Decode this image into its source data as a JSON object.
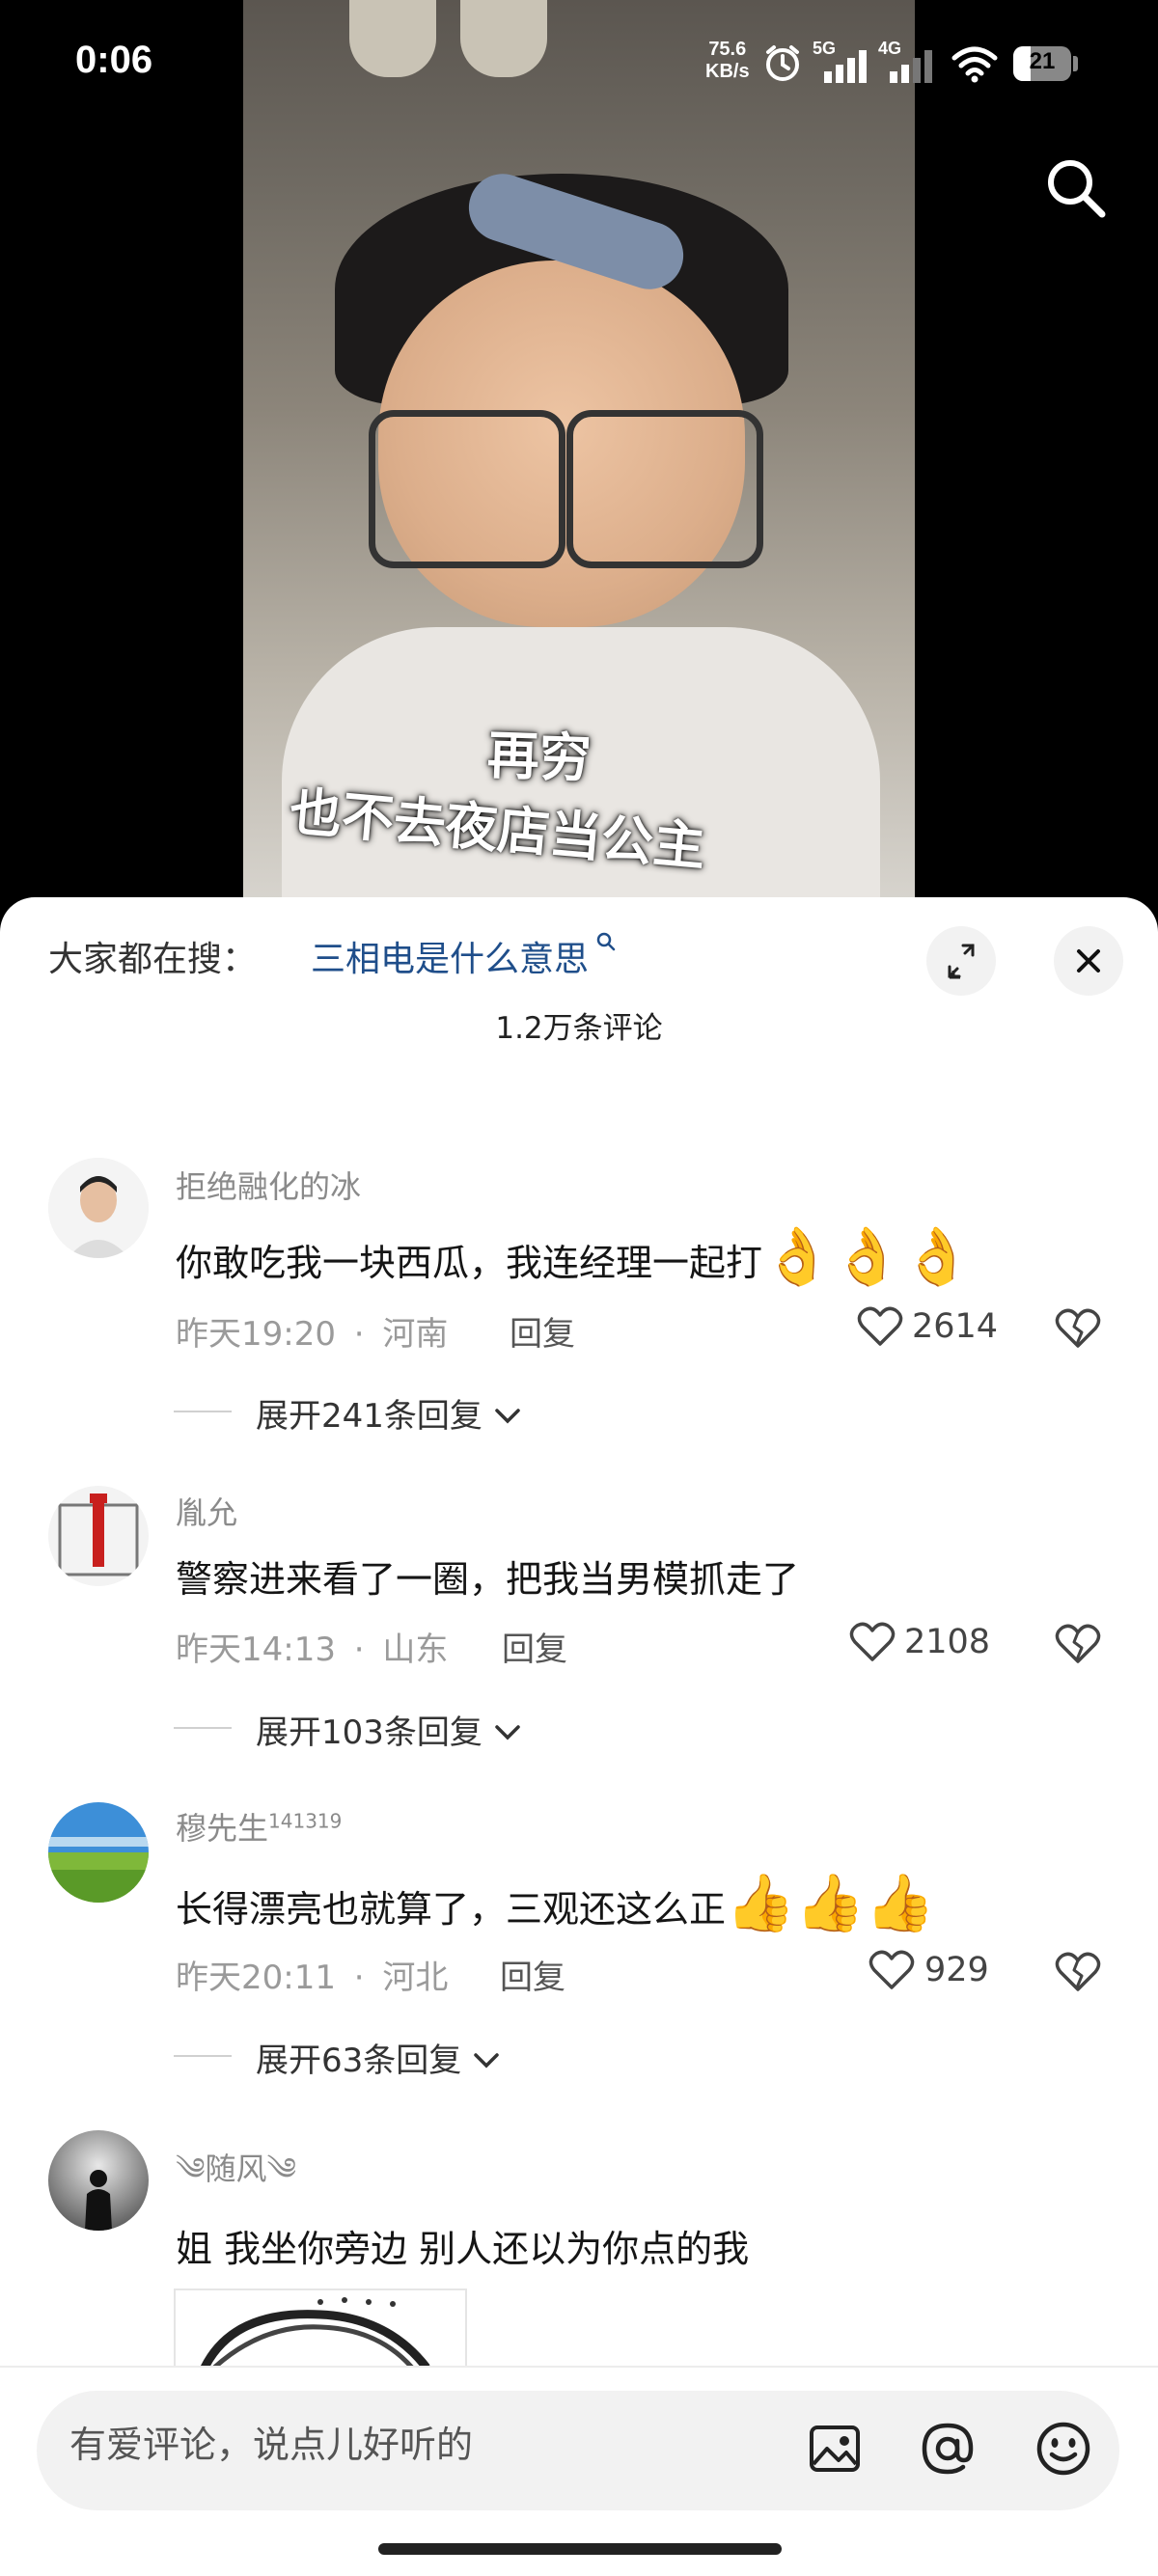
{
  "status_bar": {
    "time": "0:06",
    "net_speed_value": "75.6",
    "net_speed_unit": "KB/s",
    "net_5g": "5G",
    "net_4g": "4G",
    "battery": "21"
  },
  "video": {
    "caption_line_1": "再穷",
    "caption_line_2": "也不去夜店当公主"
  },
  "sheet": {
    "search_prefix": "大家都在搜：",
    "search_suggestion": "三相电是什么意思",
    "comment_count": "1.2万条评论"
  },
  "comments": [
    {
      "username": "拒绝融化的冰",
      "text": "你敢吃我一块西瓜，我连经理一起打",
      "emojis": "👌👌👌",
      "time": "昨天19:20",
      "location": "河南",
      "reply_label": "回复",
      "likes": "2614",
      "expand_label": "展开241条回复"
    },
    {
      "username": "胤允",
      "text": "警察进来看了一圈，把我当男模抓走了",
      "emojis": "",
      "time": "昨天14:13",
      "location": "山东",
      "reply_label": "回复",
      "likes": "2108",
      "expand_label": "展开103条回复"
    },
    {
      "username": "穆先生",
      "username_sup": "141319",
      "text": "长得漂亮也就算了，三观还这么正",
      "emojis": "👍👍👍",
      "time": "昨天20:11",
      "location": "河北",
      "reply_label": "回复",
      "likes": "929",
      "expand_label": "展开63条回复"
    },
    {
      "username": "༄随风༄",
      "text": "姐 我坐你旁边 别人还以为你点的我"
    }
  ],
  "composer": {
    "placeholder": "有爱评论，说点儿好听的"
  },
  "separator": "·",
  "colors": {
    "link_blue": "#1f4e8a",
    "sheet_bg": "#ffffff",
    "input_bg": "#f2f2f2"
  },
  "icons": [
    "search-icon",
    "expand-icon",
    "close-icon",
    "heart-icon",
    "broken-heart-icon",
    "chevron-down-icon",
    "image-icon",
    "at-icon",
    "smiley-icon",
    "alarm-icon",
    "signal-icon",
    "wifi-icon",
    "battery-icon"
  ]
}
